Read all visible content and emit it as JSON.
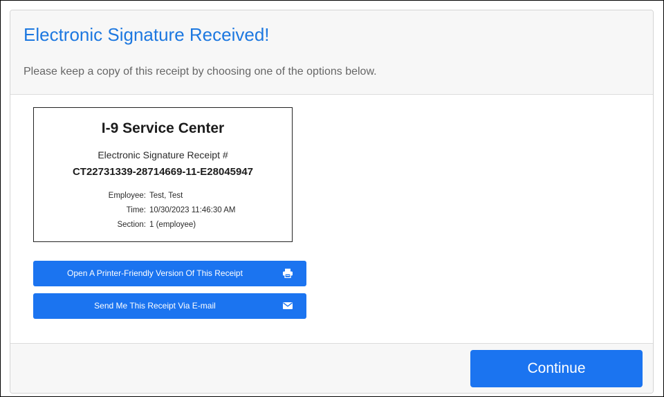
{
  "modal": {
    "title": "Electronic Signature Received!",
    "subtitle": "Please keep a copy of this receipt by choosing one of the options below."
  },
  "receipt": {
    "title": "I-9 Service Center",
    "label": "Electronic Signature Receipt #",
    "number": "CT22731339-28714669-11-E28045947",
    "details": [
      {
        "key": "Employee:",
        "value": "Test, Test"
      },
      {
        "key": "Time:",
        "value": "10/30/2023 11:46:30 AM"
      },
      {
        "key": "Section:",
        "value": "1 (employee)"
      }
    ]
  },
  "actions": {
    "print_label": "Open A Printer-Friendly Version Of This Receipt",
    "print_icon": "printer-icon",
    "email_label": "Send Me This Receipt Via E-mail",
    "email_icon": "envelope-icon"
  },
  "footer": {
    "continue_label": "Continue"
  },
  "colors": {
    "accent": "#1b74f0",
    "title": "#1d78e0",
    "header_bg": "#f7f7f7"
  }
}
